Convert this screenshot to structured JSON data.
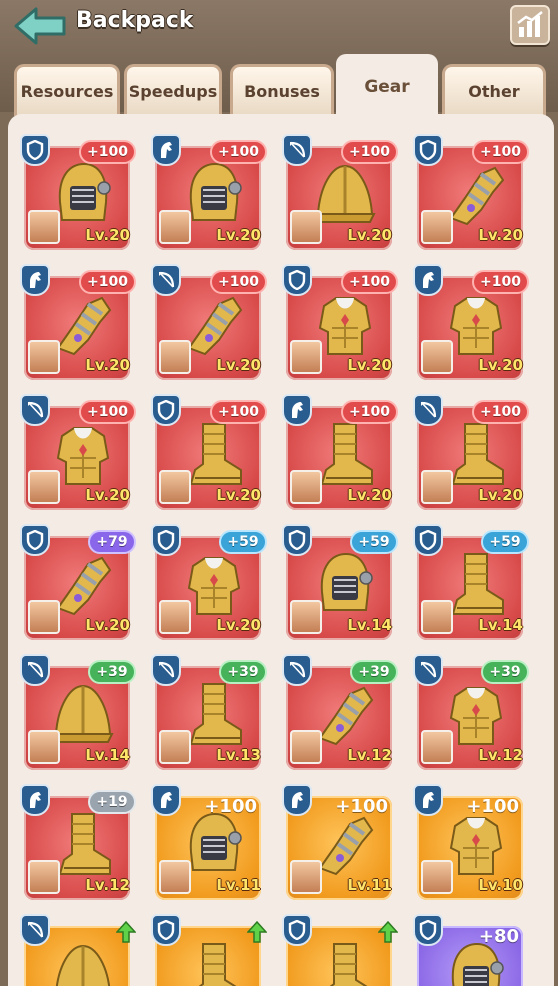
{
  "header": {
    "title": "Backpack"
  },
  "tabs": [
    {
      "label": "Resources",
      "active": false
    },
    {
      "label": "Speedups",
      "active": false
    },
    {
      "label": "Bonuses",
      "active": false
    },
    {
      "label": "Gear",
      "active": true
    },
    {
      "label": "Other",
      "active": false
    }
  ],
  "colors": {
    "red_rarity": "#d84a4a",
    "gold_rarity": "#f19b1e",
    "purple_rarity": "#8b68e6",
    "type_badge": "#2a5d8f",
    "level_text": "#ffe66b"
  },
  "items": [
    {
      "type": "shield",
      "bonus": "+100",
      "bonus_color": "red",
      "level": "Lv.20",
      "rarity": "red",
      "gear": "helmet"
    },
    {
      "type": "horse",
      "bonus": "+100",
      "bonus_color": "red",
      "level": "Lv.20",
      "rarity": "red",
      "gear": "helmet"
    },
    {
      "type": "bow",
      "bonus": "+100",
      "bonus_color": "red",
      "level": "Lv.20",
      "rarity": "red",
      "gear": "hat"
    },
    {
      "type": "shield",
      "bonus": "+100",
      "bonus_color": "red",
      "level": "Lv.20",
      "rarity": "red",
      "gear": "gauntlet"
    },
    {
      "type": "horse",
      "bonus": "+100",
      "bonus_color": "red",
      "level": "Lv.20",
      "rarity": "red",
      "gear": "gauntlet"
    },
    {
      "type": "bow",
      "bonus": "+100",
      "bonus_color": "red",
      "level": "Lv.20",
      "rarity": "red",
      "gear": "gauntlet"
    },
    {
      "type": "shield",
      "bonus": "+100",
      "bonus_color": "red",
      "level": "Lv.20",
      "rarity": "red",
      "gear": "armor"
    },
    {
      "type": "horse",
      "bonus": "+100",
      "bonus_color": "red",
      "level": "Lv.20",
      "rarity": "red",
      "gear": "armor"
    },
    {
      "type": "bow",
      "bonus": "+100",
      "bonus_color": "red",
      "level": "Lv.20",
      "rarity": "red",
      "gear": "armor"
    },
    {
      "type": "shield",
      "bonus": "+100",
      "bonus_color": "red",
      "level": "Lv.20",
      "rarity": "red",
      "gear": "boot"
    },
    {
      "type": "horse",
      "bonus": "+100",
      "bonus_color": "red",
      "level": "Lv.20",
      "rarity": "red",
      "gear": "boot"
    },
    {
      "type": "bow",
      "bonus": "+100",
      "bonus_color": "red",
      "level": "Lv.20",
      "rarity": "red",
      "gear": "boot"
    },
    {
      "type": "shield",
      "bonus": "+79",
      "bonus_color": "purple",
      "level": "Lv.20",
      "rarity": "red",
      "gear": "gauntlet"
    },
    {
      "type": "shield",
      "bonus": "+59",
      "bonus_color": "blue",
      "level": "Lv.20",
      "rarity": "red",
      "gear": "armor"
    },
    {
      "type": "shield",
      "bonus": "+59",
      "bonus_color": "blue",
      "level": "Lv.14",
      "rarity": "red",
      "gear": "helmet"
    },
    {
      "type": "shield",
      "bonus": "+59",
      "bonus_color": "blue",
      "level": "Lv.14",
      "rarity": "red",
      "gear": "boot"
    },
    {
      "type": "bow",
      "bonus": "+39",
      "bonus_color": "green",
      "level": "Lv.14",
      "rarity": "red",
      "gear": "hat"
    },
    {
      "type": "bow",
      "bonus": "+39",
      "bonus_color": "green",
      "level": "Lv.13",
      "rarity": "red",
      "gear": "boot"
    },
    {
      "type": "bow",
      "bonus": "+39",
      "bonus_color": "green",
      "level": "Lv.12",
      "rarity": "red",
      "gear": "gauntlet"
    },
    {
      "type": "bow",
      "bonus": "+39",
      "bonus_color": "green",
      "level": "Lv.12",
      "rarity": "red",
      "gear": "armor"
    },
    {
      "type": "horse",
      "bonus": "+19",
      "bonus_color": "gray",
      "level": "Lv.12",
      "rarity": "red",
      "gear": "boot"
    },
    {
      "type": "horse",
      "bonus": "+100",
      "bonus_color": "plain",
      "level": "Lv.11",
      "rarity": "gold",
      "gear": "helmet"
    },
    {
      "type": "horse",
      "bonus": "+100",
      "bonus_color": "plain",
      "level": "Lv.11",
      "rarity": "gold",
      "gear": "gauntlet"
    },
    {
      "type": "horse",
      "bonus": "+100",
      "bonus_color": "plain",
      "level": "Lv.10",
      "rarity": "gold",
      "gear": "armor"
    },
    {
      "type": "bow",
      "bonus": "",
      "bonus_color": "arrow",
      "level": "",
      "rarity": "gold",
      "gear": "hat"
    },
    {
      "type": "shield",
      "bonus": "",
      "bonus_color": "arrow",
      "level": "",
      "rarity": "gold",
      "gear": "boot"
    },
    {
      "type": "shield",
      "bonus": "",
      "bonus_color": "arrow",
      "level": "",
      "rarity": "gold",
      "gear": "boot"
    },
    {
      "type": "shield",
      "bonus": "+80",
      "bonus_color": "plain",
      "level": "",
      "rarity": "purple",
      "gear": "helmet"
    }
  ]
}
